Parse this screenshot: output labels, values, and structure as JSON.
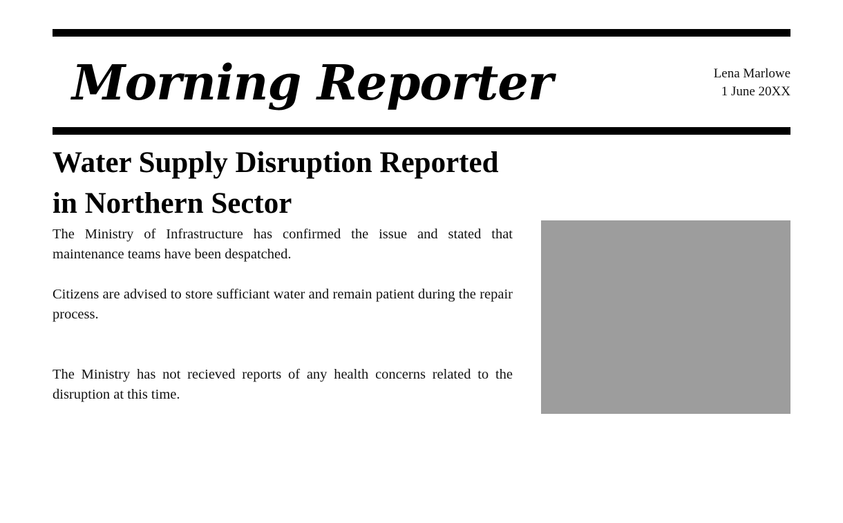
{
  "masthead": {
    "title": "Morning Reporter",
    "author": "Lena Marlowe",
    "date": "1 June 20XX"
  },
  "article": {
    "headline": "Water Supply Disruption Reported in Northern Sector",
    "paragraphs": [
      "The Ministry of Infrastructure has confirmed the issue and stated that maintenance teams have been despatched.",
      "Citizens are advised to store sufficiant water and remain patient during the repair process.",
      "The Ministry has not recieved reports of any health concerns related to the disruption at this time."
    ]
  },
  "colors": {
    "rule": "#000000",
    "image_placeholder": "#9d9d9d",
    "background": "#ffffff"
  }
}
